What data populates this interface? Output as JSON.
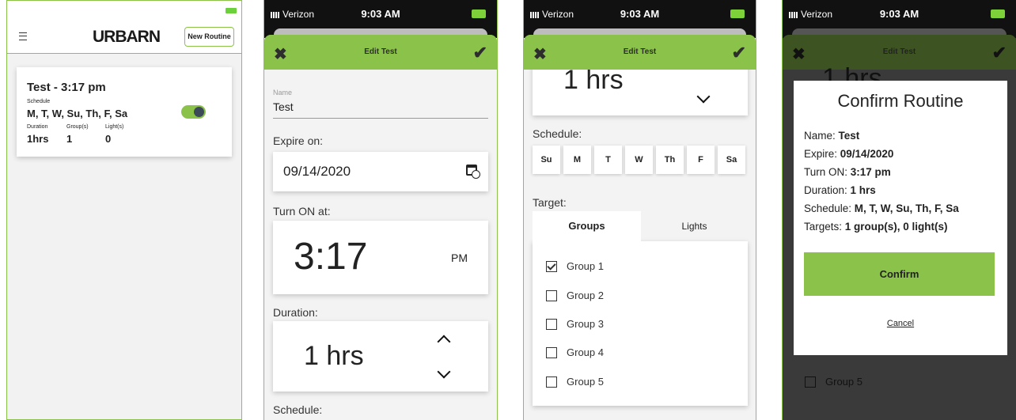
{
  "colors": {
    "accent": "#8bc34a",
    "dark": "#111111",
    "dim": "#3a3a3a"
  },
  "status": {
    "carrier": "Verizon",
    "time": "9:03 AM"
  },
  "s1": {
    "logo": "URBARN",
    "new_routine": "New Routine",
    "routine": {
      "title": "Test - 3:17 pm",
      "schedule_label": "Schedule",
      "schedule": "M, T, W, Su, Th, F, Sa",
      "duration_label": "Duration",
      "duration": "1hrs",
      "groups_label": "Group(s)",
      "groups": "1",
      "lights_label": "Light(s)",
      "lights": "0",
      "enabled": true
    }
  },
  "edit": {
    "header_title": "Edit Test",
    "name_label": "Name",
    "name_value": "Test",
    "expire_label": "Expire on:",
    "expire_value": "09/14/2020",
    "turn_on_label": "Turn ON at:",
    "time_value": "3:17",
    "ampm": "PM",
    "duration_label": "Duration:",
    "duration_value": "1 hrs",
    "schedule_label": "Schedule:",
    "days": [
      "Su",
      "M",
      "T",
      "W",
      "Th",
      "F",
      "Sa"
    ],
    "target_label": "Target:",
    "tabs": [
      "Groups",
      "Lights"
    ],
    "groups": [
      {
        "name": "Group 1",
        "checked": true
      },
      {
        "name": "Group 2",
        "checked": false
      },
      {
        "name": "Group 3",
        "checked": false
      },
      {
        "name": "Group 4",
        "checked": false
      },
      {
        "name": "Group 5",
        "checked": false
      }
    ]
  },
  "confirm": {
    "title": "Confirm Routine",
    "name_k": "Name: ",
    "name_v": "Test",
    "expire_k": "Expire: ",
    "expire_v": "09/14/2020",
    "turn_k": "Turn ON: ",
    "turn_v": "3:17 pm",
    "dur_k": "Duration: ",
    "dur_v": "1 hrs",
    "sched_k": "Schedule: ",
    "sched_v": "M, T, W, Su, Th, F, Sa",
    "targets_k": "Targets: ",
    "targets_v": "1 group(s), 0 light(s)",
    "confirm_btn": "Confirm",
    "cancel": "Cancel",
    "bg_duration": "1 hrs",
    "bg_group": "Group 5"
  }
}
